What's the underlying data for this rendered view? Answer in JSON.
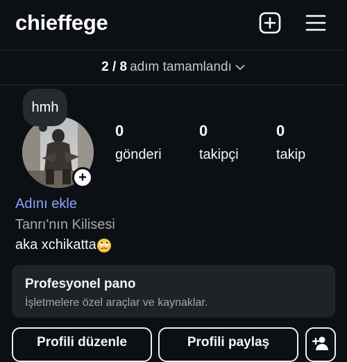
{
  "header": {
    "username": "chieffege",
    "create_icon": "plus-square-icon",
    "menu_icon": "hamburger-menu-icon"
  },
  "progress": {
    "count": "2 / 8",
    "label": "adım tamamlandı",
    "icon": "chevron-down-icon"
  },
  "profile": {
    "note": "hmh",
    "add_badge": "+",
    "stats": [
      {
        "value": "0",
        "label": "gönderi"
      },
      {
        "value": "0",
        "label": "takipçi"
      },
      {
        "value": "0",
        "label": "takip"
      }
    ],
    "add_name": "Adını ekle",
    "category": "Tanrı'nın Kilisesi",
    "bio": "aka xchikatta",
    "bio_emoji": "face-with-rolling-eyes-emoji"
  },
  "professional_dashboard": {
    "title": "Profesyonel pano",
    "subtitle": "İşletmelere özel araçlar ve kaynaklar."
  },
  "actions": {
    "edit_profile": "Profili düzenle",
    "share_profile": "Profili paylaş",
    "discover_icon": "add-person-icon"
  },
  "colors": {
    "background": "#0c1014",
    "card": "#1f2328",
    "link": "#8ea1ff",
    "muted": "#a8a8a8"
  }
}
